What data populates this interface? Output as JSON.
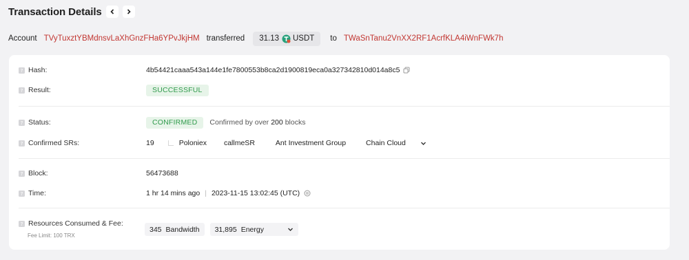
{
  "header": {
    "title": "Transaction Details"
  },
  "summary": {
    "prefix": "Account",
    "from": "TVyTuxztYBMdnsvLaXhGnzFHa6YPvJkjHM",
    "verb": "transferred",
    "amount": "31.13",
    "token": "USDT",
    "to_word": "to",
    "to": "TWaSnTanu2VnXX2RF1AcrfKLA4iWnFWk7h"
  },
  "details": {
    "hash": {
      "label": "Hash:",
      "value": "4b54421caaa543a144e1fe7800553b8ca2d1900819eca0a327342810d014a8c5"
    },
    "result": {
      "label": "Result:",
      "value": "SUCCESSFUL"
    },
    "status": {
      "label": "Status:",
      "value": "CONFIRMED",
      "note_prefix": "Confirmed by over",
      "note_count": "200",
      "note_suffix": "blocks"
    },
    "confirmed_srs": {
      "label": "Confirmed SRs:",
      "count": "19",
      "names": [
        "Poloniex",
        "callmeSR",
        "Ant Investment Group",
        "Chain Cloud"
      ]
    },
    "block": {
      "label": "Block:",
      "value": "56473688"
    },
    "time": {
      "label": "Time:",
      "ago": "1 hr 14 mins ago",
      "sep": "|",
      "utc": "2023-11-15 13:02:45 (UTC)"
    },
    "resources": {
      "label": "Resources Consumed & Fee:",
      "fee_limit": "Fee Limit: 100 TRX",
      "bandwidth_value": "345",
      "bandwidth_label": "Bandwidth",
      "energy_value": "31,895",
      "energy_label": "Energy"
    }
  },
  "colors": {
    "address": "#c23631",
    "success_bg": "#e7f4e9",
    "success_text": "#2f9a4b",
    "token": "#26a17b"
  }
}
